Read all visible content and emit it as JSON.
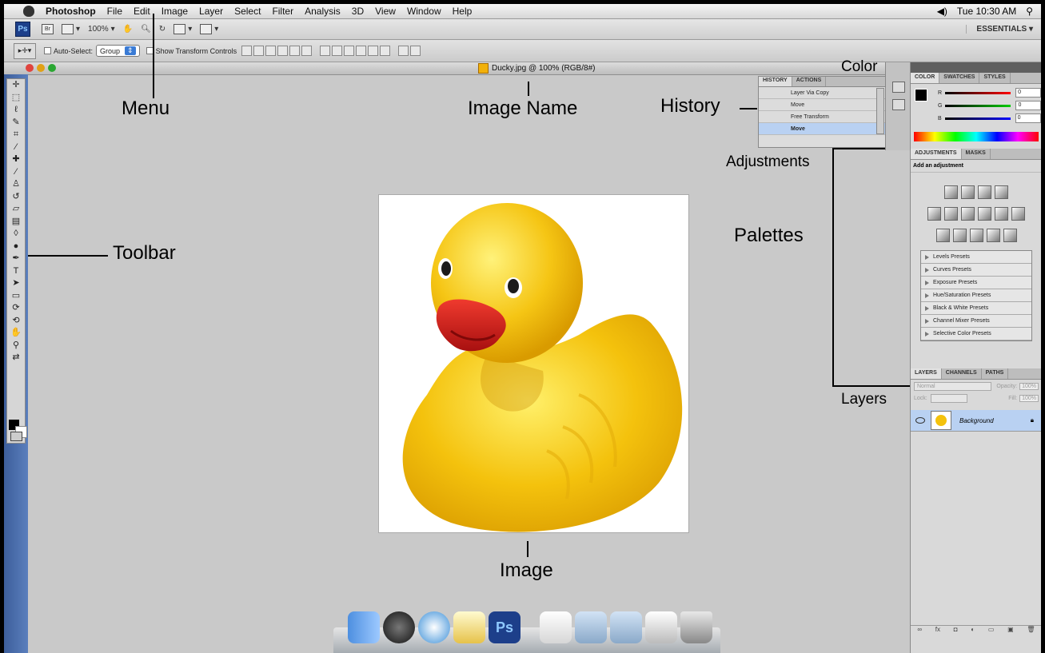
{
  "menubar": {
    "app_name": "Photoshop",
    "items": [
      "File",
      "Edit",
      "Image",
      "Layer",
      "Select",
      "Filter",
      "Analysis",
      "3D",
      "View",
      "Window",
      "Help"
    ],
    "clock": "Tue 10:30 AM"
  },
  "appbar": {
    "ps_badge": "Ps",
    "br_badge": "Br",
    "zoom": "100%",
    "workspace": "ESSENTIALS ▾"
  },
  "options": {
    "auto_select_label": "Auto-Select:",
    "auto_select_value": "Group",
    "transform_label": "Show Transform Controls"
  },
  "document": {
    "title": "Ducky.jpg @ 100% (RGB/8#)"
  },
  "history": {
    "tabs": [
      "HISTORY",
      "ACTIONS"
    ],
    "rows": [
      "Layer Via Copy",
      "Move",
      "Free Transform",
      "Move"
    ]
  },
  "color_panel": {
    "tabs": [
      "COLOR",
      "SWATCHES",
      "STYLES"
    ],
    "r_label": "R",
    "g_label": "G",
    "b_label": "B",
    "r": "0",
    "g": "0",
    "b": "0"
  },
  "adjustments": {
    "tabs": [
      "ADJUSTMENTS",
      "MASKS"
    ],
    "title": "Add an adjustment",
    "presets": [
      "Levels Presets",
      "Curves Presets",
      "Exposure Presets",
      "Hue/Saturation Presets",
      "Black & White Presets",
      "Channel Mixer Presets",
      "Selective Color Presets"
    ]
  },
  "layers": {
    "tabs": [
      "LAYERS",
      "CHANNELS",
      "PATHS"
    ],
    "blend_mode": "Normal",
    "opacity_label": "Opacity:",
    "opacity_value": "100%",
    "lock_label": "Lock:",
    "fill_label": "Fill:",
    "fill_value": "100%",
    "layer_name": "Background"
  },
  "annotations": {
    "menu": "Menu",
    "image_name": "Image Name",
    "history": "History",
    "color": "Color",
    "adjustments": "Adjustments",
    "palettes": "Palettes",
    "layers": "Layers",
    "toolbar": "Toolbar",
    "image": "Image"
  },
  "colors": {
    "duck_yellow": "#f4c20d",
    "beak_red": "#d51f1f",
    "selection_blue": "#b9d1f2",
    "toolbar_blue": "#4a6fae"
  }
}
